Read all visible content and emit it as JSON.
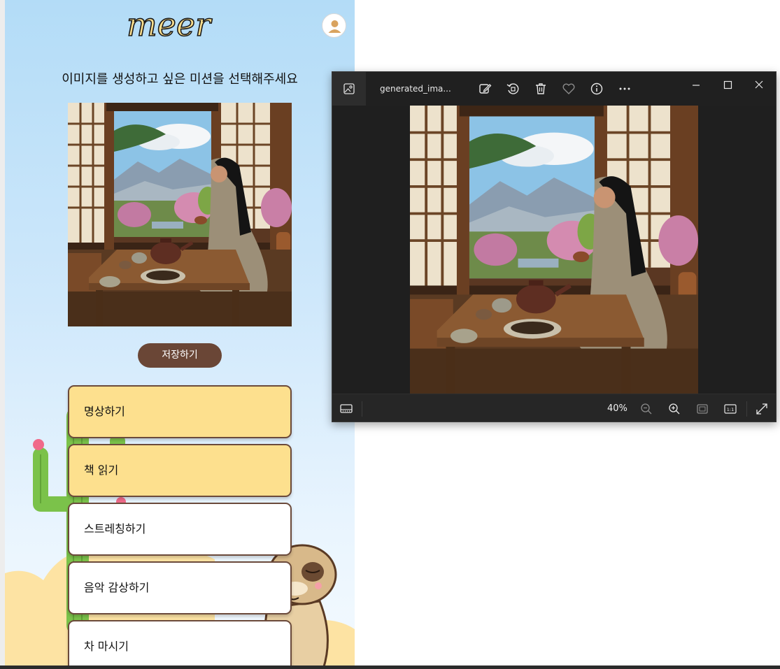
{
  "app": {
    "logo_text": "meer",
    "heading": "이미지를 생성하고 싶은 미션을 선택해주세요",
    "save_label": "저장하기",
    "missions": [
      {
        "label": "명상하기",
        "selected": true
      },
      {
        "label": "책 읽기",
        "selected": true
      },
      {
        "label": "스트레칭하기",
        "selected": false
      },
      {
        "label": "음악 감상하기",
        "selected": false
      },
      {
        "label": "차 마시기",
        "selected": false
      }
    ],
    "icons": [
      "user-icon"
    ],
    "colors": {
      "accent": "#6a4636",
      "selected_bg": "#fde08e",
      "border": "#6b4a3b"
    }
  },
  "viewer": {
    "file_name": "generated_ima...",
    "zoom": "40%",
    "toolbar_icons": [
      "edit-icon",
      "rotate-icon",
      "delete-icon",
      "favorite-icon",
      "info-icon",
      "more-icon"
    ],
    "window_icons": [
      "minimize-icon",
      "maximize-icon",
      "close-icon"
    ],
    "bottom_icons": [
      "filmstrip-icon",
      "zoom-out-icon",
      "zoom-in-icon",
      "fit-icon",
      "actual-size-icon",
      "fullscreen-icon"
    ],
    "actual_size_label": "1:1"
  }
}
